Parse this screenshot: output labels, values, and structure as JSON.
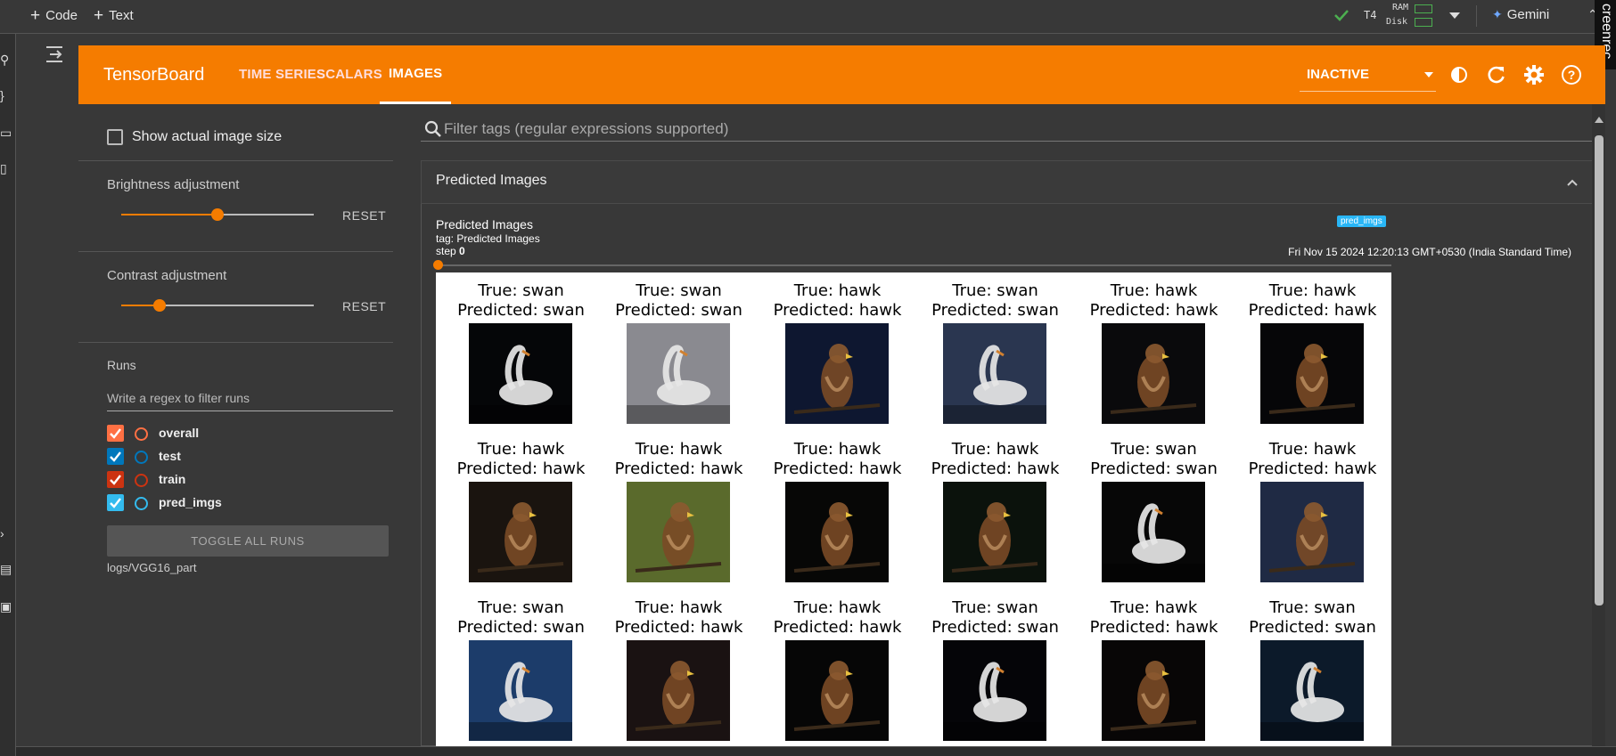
{
  "colab": {
    "code_label": "Code",
    "text_label": "Text",
    "runtime": "T4",
    "ram_label": "RAM",
    "disk_label": "Disk",
    "gemini_label": "Gemini",
    "screenrec_label": "creenrec"
  },
  "tensorboard": {
    "logo": "TensorBoard",
    "tabs": [
      {
        "label": "TIME SERIES",
        "active": false
      },
      {
        "label": "SCALARS",
        "active": false
      },
      {
        "label": "IMAGES",
        "active": true
      }
    ],
    "status": "INACTIVE",
    "icons": [
      "brightness-icon",
      "refresh-icon",
      "settings-icon",
      "help-icon"
    ]
  },
  "sidebar": {
    "show_actual_size": "Show actual image size",
    "brightness": {
      "label": "Brightness adjustment",
      "value": 0.5,
      "reset": "RESET"
    },
    "contrast": {
      "label": "Contrast adjustment",
      "value": 0.2,
      "reset": "RESET"
    },
    "runs": {
      "title": "Runs",
      "filter_placeholder": "Write a regex to filter runs",
      "items": [
        {
          "name": "overall",
          "color": "#ff7043",
          "checked": true
        },
        {
          "name": "test",
          "color": "#0077bb",
          "checked": true
        },
        {
          "name": "train",
          "color": "#cc3311",
          "checked": true
        },
        {
          "name": "pred_imgs",
          "color": "#33bbee",
          "checked": true
        }
      ],
      "toggle_all": "TOGGLE ALL RUNS",
      "logdir": "logs/VGG16_part"
    }
  },
  "main": {
    "filter_placeholder": "Filter tags (regular expressions supported)",
    "section_title": "Predicted Images",
    "card": {
      "title": "Predicted Images",
      "tag_line": "tag: Predicted Images",
      "step_label": "step",
      "step_value": "0",
      "run_badge": "pred_imgs",
      "timestamp": "Fri Nov 15 2024 12:20:13 GMT+0530 (India Standard Time)",
      "grid": [
        {
          "true": "True: swan",
          "pred": "Predicted: swan",
          "subject": "swan",
          "bg": "#050608"
        },
        {
          "true": "True: swan",
          "pred": "Predicted: swan",
          "subject": "swan",
          "bg": "#8a8a90"
        },
        {
          "true": "True: hawk",
          "pred": "Predicted: hawk",
          "subject": "hawk",
          "bg": "#0e1730"
        },
        {
          "true": "True: swan",
          "pred": "Predicted: swan",
          "subject": "swan",
          "bg": "#2a3650"
        },
        {
          "true": "True: hawk",
          "pred": "Predicted: hawk",
          "subject": "hawk",
          "bg": "#0a0a0c"
        },
        {
          "true": "True: hawk",
          "pred": "Predicted: hawk",
          "subject": "hawk",
          "bg": "#060608"
        },
        {
          "true": "True: hawk",
          "pred": "Predicted: hawk",
          "subject": "hawk",
          "bg": "#1a140f"
        },
        {
          "true": "True: hawk",
          "pred": "Predicted: hawk",
          "subject": "hawk",
          "bg": "#5a6a2c"
        },
        {
          "true": "True: hawk",
          "pred": "Predicted: hawk",
          "subject": "hawk",
          "bg": "#070706"
        },
        {
          "true": "True: hawk",
          "pred": "Predicted: hawk",
          "subject": "hawk",
          "bg": "#0b120c"
        },
        {
          "true": "True: swan",
          "pred": "Predicted: swan",
          "subject": "swan",
          "bg": "#070707"
        },
        {
          "true": "True: hawk",
          "pred": "Predicted: hawk",
          "subject": "hawk",
          "bg": "#1f2a44"
        },
        {
          "true": "True: swan",
          "pred": "Predicted: swan",
          "subject": "swan",
          "bg": "#1c3c6a"
        },
        {
          "true": "True: hawk",
          "pred": "Predicted: hawk",
          "subject": "hawk",
          "bg": "#1a1212"
        },
        {
          "true": "True: hawk",
          "pred": "Predicted: hawk",
          "subject": "hawk",
          "bg": "#060606"
        },
        {
          "true": "True: swan",
          "pred": "Predicted: swan",
          "subject": "swan",
          "bg": "#050508"
        },
        {
          "true": "True: hawk",
          "pred": "Predicted: hawk",
          "subject": "hawk",
          "bg": "#080606"
        },
        {
          "true": "True: swan",
          "pred": "Predicted: swan",
          "subject": "swan",
          "bg": "#0c1a2a"
        }
      ]
    }
  },
  "colors": {
    "accent": "#f57c00",
    "background": "#383838"
  }
}
